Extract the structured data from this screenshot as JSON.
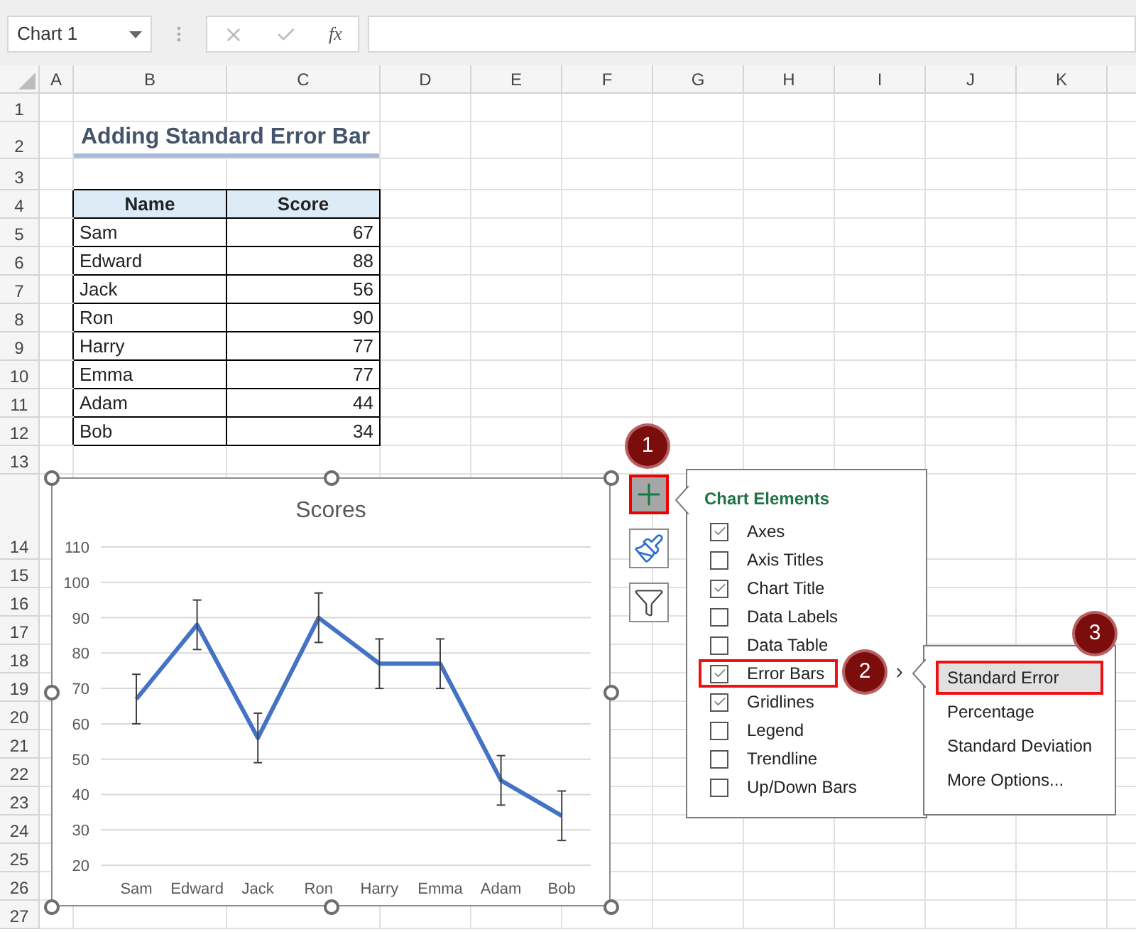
{
  "name_box": "Chart 1",
  "function_label": "fx",
  "columns": [
    "A",
    "B",
    "C",
    "D",
    "E",
    "F",
    "G",
    "H",
    "I",
    "J",
    "K"
  ],
  "rows": [
    "1",
    "2",
    "3",
    "4",
    "5",
    "6",
    "7",
    "8",
    "9",
    "10",
    "11",
    "12",
    "13",
    "14",
    "15",
    "16",
    "17",
    "18",
    "19",
    "20",
    "21",
    "22",
    "23",
    "24",
    "25",
    "26",
    "27"
  ],
  "title": "Adding Standard Error Bar",
  "table": {
    "columns": [
      "Name",
      "Score"
    ],
    "rows": [
      [
        "Sam",
        "67"
      ],
      [
        "Edward",
        "88"
      ],
      [
        "Jack",
        "56"
      ],
      [
        "Ron",
        "90"
      ],
      [
        "Harry",
        "77"
      ],
      [
        "Emma",
        "77"
      ],
      [
        "Adam",
        "44"
      ],
      [
        "Bob",
        "34"
      ]
    ]
  },
  "chart": {
    "chart_data": {
      "type": "line",
      "title": "Scores",
      "categories": [
        "Sam",
        "Edward",
        "Jack",
        "Ron",
        "Harry",
        "Emma",
        "Adam",
        "Bob"
      ],
      "series": [
        {
          "color": "#4472c4",
          "values": [
            67,
            88,
            56,
            90,
            77,
            77,
            44,
            34
          ]
        }
      ],
      "ylim": [
        20,
        110
      ],
      "yticks": [
        20,
        30,
        40,
        50,
        60,
        70,
        80,
        90,
        100,
        110
      ],
      "grid": true
    }
  },
  "chart_buttons": [
    {
      "kind": "add",
      "selected": true
    },
    {
      "kind": "style",
      "selected": false
    },
    {
      "kind": "filter",
      "selected": false
    }
  ],
  "steps": [
    "1",
    "2",
    "3"
  ],
  "chart_elements": {
    "title": "Chart Elements",
    "items": [
      {
        "label": "Axes",
        "checked": true,
        "highlighted": false,
        "submenu": false
      },
      {
        "label": "Axis Titles",
        "checked": false,
        "highlighted": false,
        "submenu": false
      },
      {
        "label": "Chart Title",
        "checked": true,
        "highlighted": false,
        "submenu": false
      },
      {
        "label": "Data Labels",
        "checked": false,
        "highlighted": false,
        "submenu": false
      },
      {
        "label": "Data Table",
        "checked": false,
        "highlighted": false,
        "submenu": false
      },
      {
        "label": "Error Bars",
        "checked": true,
        "highlighted": true,
        "submenu": true
      },
      {
        "label": "Gridlines",
        "checked": true,
        "highlighted": false,
        "submenu": false
      },
      {
        "label": "Legend",
        "checked": false,
        "highlighted": false,
        "submenu": false
      },
      {
        "label": "Trendline",
        "checked": false,
        "highlighted": false,
        "submenu": false
      },
      {
        "label": "Up/Down Bars",
        "checked": false,
        "highlighted": false,
        "submenu": false
      }
    ]
  },
  "submenu": {
    "items": [
      {
        "label": "Standard Error",
        "selected": true
      },
      {
        "label": "Percentage",
        "selected": false
      },
      {
        "label": "Standard Deviation",
        "selected": false
      },
      {
        "label": "More Options...",
        "selected": false
      }
    ]
  }
}
